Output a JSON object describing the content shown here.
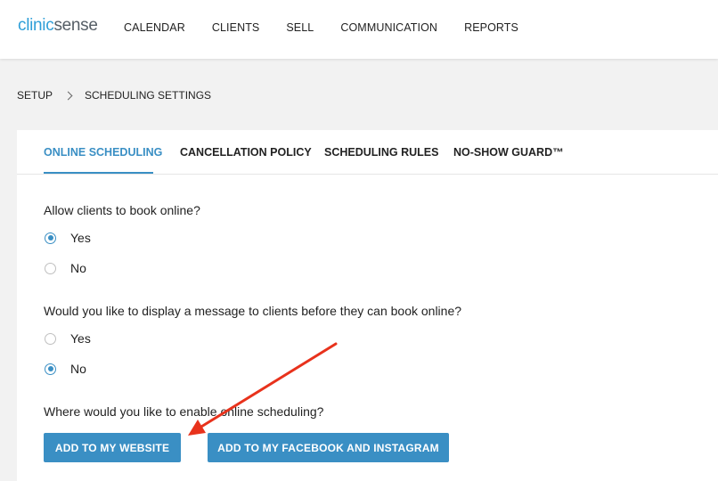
{
  "brand": {
    "logo_part1": "clinic",
    "logo_part2": "sense"
  },
  "nav": {
    "items": [
      "CALENDAR",
      "CLIENTS",
      "SELL",
      "COMMUNICATION",
      "REPORTS"
    ]
  },
  "breadcrumb": {
    "root": "SETUP",
    "current": "SCHEDULING SETTINGS"
  },
  "tabs": [
    {
      "label": "ONLINE SCHEDULING",
      "active": true
    },
    {
      "label": "CANCELLATION POLICY",
      "active": false
    },
    {
      "label": "SCHEDULING RULES",
      "active": false
    },
    {
      "label": "NO-SHOW GUARD™",
      "active": false
    }
  ],
  "questions": {
    "book_online": {
      "text": "Allow clients to book online?",
      "options": [
        "Yes",
        "No"
      ],
      "selected": "Yes"
    },
    "display_message": {
      "text": "Would you like to display a message to clients before they can book online?",
      "options": [
        "Yes",
        "No"
      ],
      "selected": "No"
    },
    "enable_where": {
      "text": "Where would you like to enable online scheduling?"
    }
  },
  "buttons": {
    "website": "ADD TO MY WEBSITE",
    "facebook": "ADD TO MY FACEBOOK AND INSTAGRAM"
  },
  "colors": {
    "accent": "#3a8fc4",
    "annotation_arrow": "#e8321c",
    "background": "#f2f2f2"
  },
  "annotation": {
    "type": "red-arrow",
    "points_to": "add-to-website-button"
  }
}
